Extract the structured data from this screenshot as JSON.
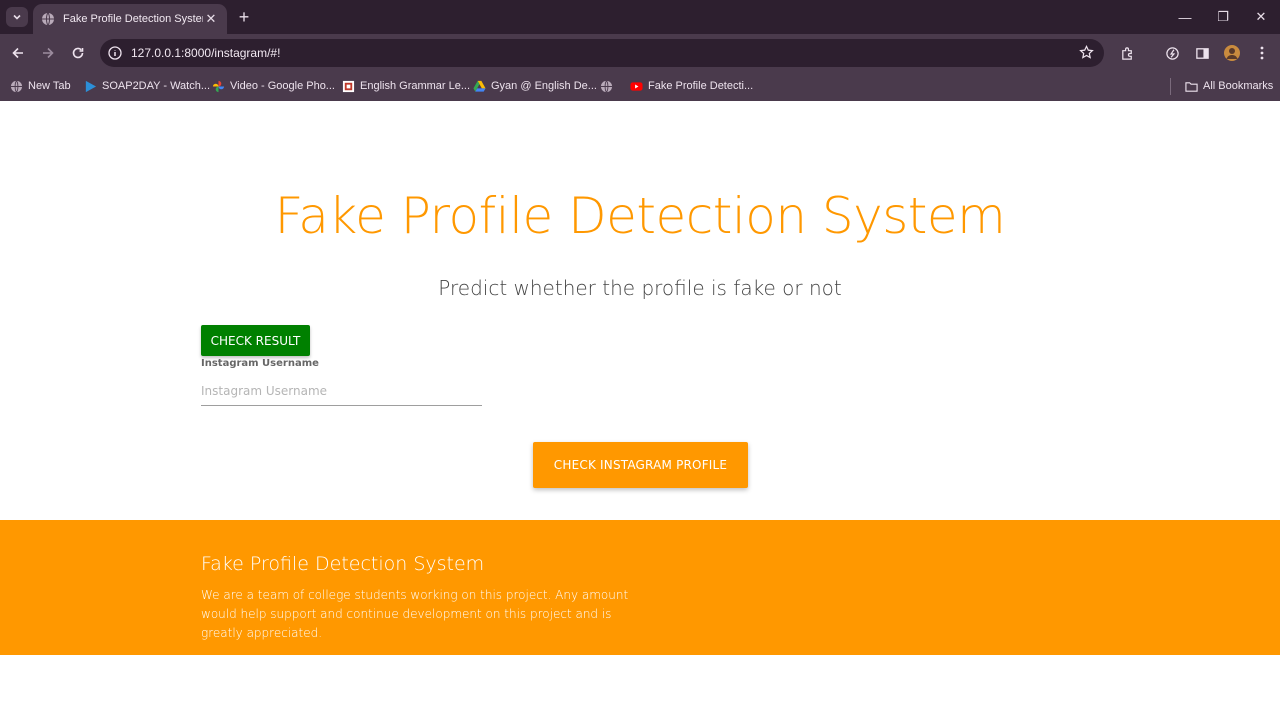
{
  "browser": {
    "tab_title": "Fake Profile Detection System",
    "url": "127.0.0.1:8000/instagram/#!",
    "bookmarks": [
      {
        "label": "New Tab",
        "icon": "globe-icon"
      },
      {
        "label": "SOAP2DAY - Watch...",
        "icon": "play-icon"
      },
      {
        "label": "Video - Google Pho...",
        "icon": "google-photos-icon"
      },
      {
        "label": "English Grammar Le...",
        "icon": "site-icon"
      },
      {
        "label": "Gyan @ English De...",
        "icon": "google-drive-icon"
      },
      {
        "label": "",
        "icon": "globe-icon"
      },
      {
        "label": "Fake Profile Detecti...",
        "icon": "youtube-icon"
      }
    ],
    "all_bookmarks": "All Bookmarks"
  },
  "main": {
    "title": "Fake Profile Detection System",
    "subtitle": "Predict whether the profile is fake or not",
    "check_result_label": "CHECK RESULT",
    "username_label": "Instagram Username",
    "username_placeholder": "Instagram Username",
    "username_value": "",
    "check_profile_label": "CHECK INSTAGRAM PROFILE"
  },
  "footer": {
    "title": "Fake Profile Detection System",
    "text": "We are a team of college students working on this project. Any amount would help support and continue development on this project and is greatly appreciated."
  },
  "colors": {
    "accent": "#ff9800",
    "success": "#008000",
    "chrome_dark": "#2d1f2f",
    "chrome_light": "#4a3a4c"
  }
}
